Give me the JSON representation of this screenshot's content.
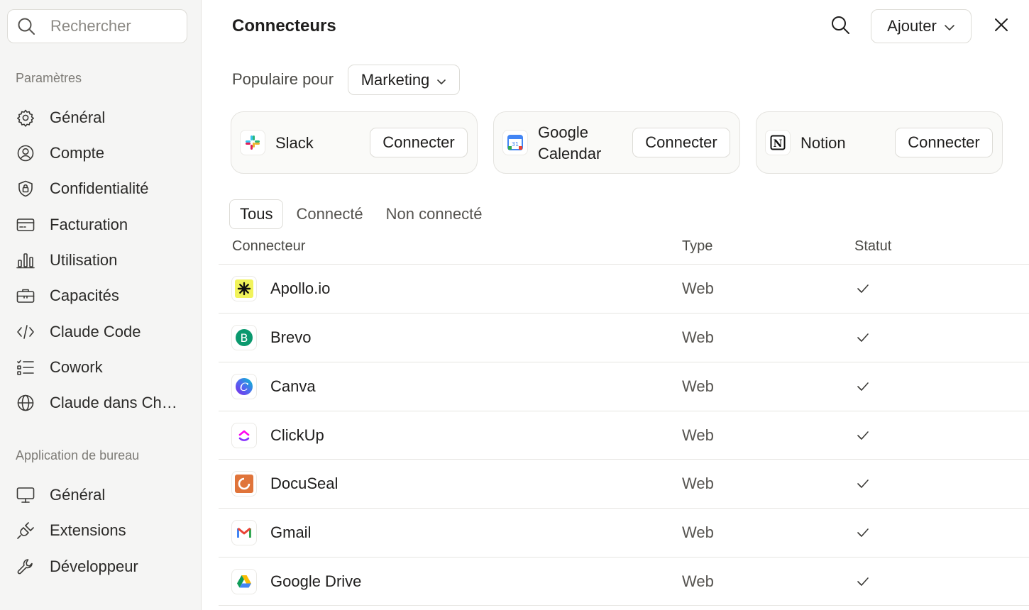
{
  "sidebar": {
    "search_placeholder": "Rechercher",
    "settings_section": "Paramètres",
    "settings_items": [
      {
        "label": "Général",
        "icon": "gear-icon"
      },
      {
        "label": "Compte",
        "icon": "user-circle-icon"
      },
      {
        "label": "Confidentialité",
        "icon": "shield-lock-icon"
      },
      {
        "label": "Facturation",
        "icon": "credit-card-icon"
      },
      {
        "label": "Utilisation",
        "icon": "bar-chart-icon"
      },
      {
        "label": "Capacités",
        "icon": "briefcase-icon"
      },
      {
        "label": "Claude Code",
        "icon": "code-icon"
      },
      {
        "label": "Cowork",
        "icon": "checklist-icon"
      },
      {
        "label": "Claude dans Ch…",
        "icon": "globe-icon"
      }
    ],
    "desktop_section": "Application de bureau",
    "desktop_items": [
      {
        "label": "Général",
        "icon": "monitor-icon"
      },
      {
        "label": "Extensions",
        "icon": "plug-icon"
      },
      {
        "label": "Développeur",
        "icon": "wrench-icon"
      }
    ]
  },
  "header": {
    "title": "Connecteurs",
    "add_label": "Ajouter"
  },
  "popular": {
    "label": "Populaire pour",
    "selected": "Marketing",
    "cards": [
      {
        "name": "Slack",
        "button": "Connecter",
        "icon": "slack-logo-icon"
      },
      {
        "name": "Google Calendar",
        "name_line1": "Google",
        "name_line2": "Calendar",
        "button": "Connecter",
        "icon": "google-calendar-logo-icon"
      },
      {
        "name": "Notion",
        "button": "Connecter",
        "icon": "notion-logo-icon"
      }
    ]
  },
  "tabs": [
    "Tous",
    "Connecté",
    "Non connecté"
  ],
  "table": {
    "headers": {
      "connector": "Connecteur",
      "type": "Type",
      "status": "Statut"
    },
    "rows": [
      {
        "name": "Apollo.io",
        "type": "Web",
        "status": "check",
        "icon": "apollo-logo-icon"
      },
      {
        "name": "Brevo",
        "type": "Web",
        "status": "check",
        "icon": "brevo-logo-icon"
      },
      {
        "name": "Canva",
        "type": "Web",
        "status": "check",
        "icon": "canva-logo-icon"
      },
      {
        "name": "ClickUp",
        "type": "Web",
        "status": "check",
        "icon": "clickup-logo-icon"
      },
      {
        "name": "DocuSeal",
        "type": "Web",
        "status": "check",
        "icon": "docuseal-logo-icon"
      },
      {
        "name": "Gmail",
        "type": "Web",
        "status": "check",
        "icon": "gmail-logo-icon"
      },
      {
        "name": "Google Drive",
        "type": "Web",
        "status": "check",
        "icon": "google-drive-logo-icon"
      }
    ]
  }
}
